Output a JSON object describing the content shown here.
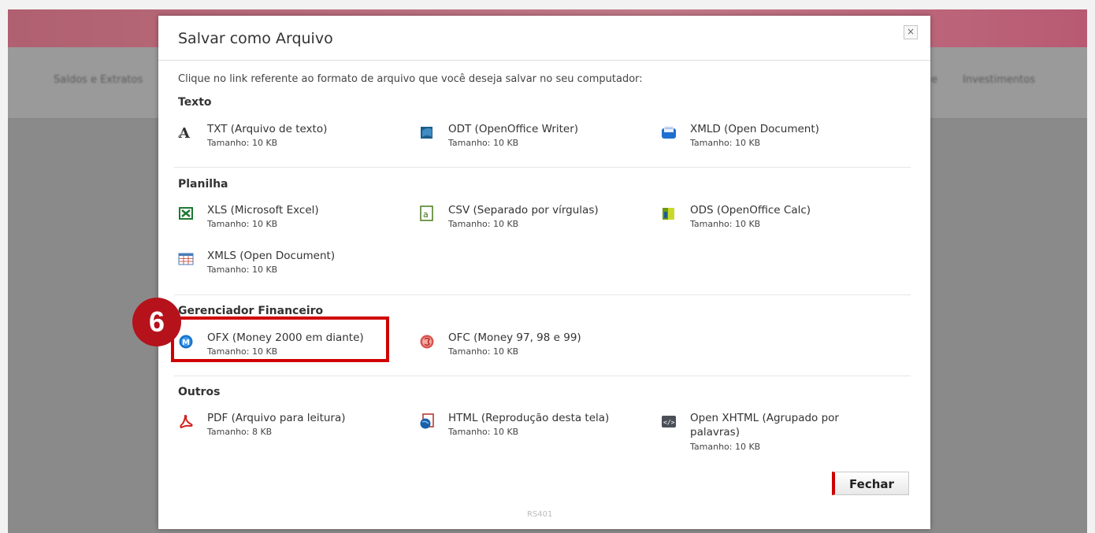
{
  "background": {
    "nav_left": "Saldos e Extratos",
    "nav_right_1": "e",
    "nav_right_2": "Investimentos"
  },
  "dialog": {
    "title": "Salvar como Arquivo",
    "close_label": "×",
    "instruction": "Clique no link referente ao formato de arquivo que você deseja salvar no seu computador:",
    "footer_code": "RS401",
    "close_button_label": "Fechar"
  },
  "sections": {
    "texto": {
      "title": "Texto",
      "items": [
        {
          "name": "TXT (Arquivo de texto)",
          "size": "Tamanho: 10 KB",
          "icon": "text-file-icon"
        },
        {
          "name": "ODT (OpenOffice Writer)",
          "size": "Tamanho: 10 KB",
          "icon": "openoffice-writer-icon"
        },
        {
          "name": "XMLD (Open Document)",
          "size": "Tamanho: 10 KB",
          "icon": "xml-document-icon"
        }
      ]
    },
    "planilha": {
      "title": "Planilha",
      "items": [
        {
          "name": "XLS (Microsoft Excel)",
          "size": "Tamanho: 10 KB",
          "icon": "excel-icon"
        },
        {
          "name": "CSV (Separado por vírgulas)",
          "size": "Tamanho: 10 KB",
          "icon": "csv-icon"
        },
        {
          "name": "ODS (OpenOffice Calc)",
          "size": "Tamanho: 10 KB",
          "icon": "openoffice-calc-icon"
        },
        {
          "name": "XMLS (Open Document)",
          "size": "Tamanho: 10 KB",
          "icon": "spreadsheet-icon"
        }
      ]
    },
    "gerenciador": {
      "title": "Gerenciador Financeiro",
      "items": [
        {
          "name": "OFX (Money 2000 em diante)",
          "size": "Tamanho: 10 KB",
          "icon": "money-ofx-icon"
        },
        {
          "name": "OFC (Money 97, 98 e 99)",
          "size": "Tamanho: 10 KB",
          "icon": "money-ofc-icon"
        }
      ]
    },
    "outros": {
      "title": "Outros",
      "items": [
        {
          "name": "PDF (Arquivo para leitura)",
          "size": "Tamanho: 8 KB",
          "icon": "pdf-icon"
        },
        {
          "name": "HTML (Reprodução desta tela)",
          "size": "Tamanho: 10 KB",
          "icon": "html-icon"
        },
        {
          "name": "Open XHTML (Agrupado por",
          "name2": "palavras)",
          "size": "Tamanho: 10 KB",
          "icon": "xhtml-icon"
        }
      ]
    }
  },
  "annotation": {
    "step_number": "6",
    "color": "#cc0000"
  }
}
